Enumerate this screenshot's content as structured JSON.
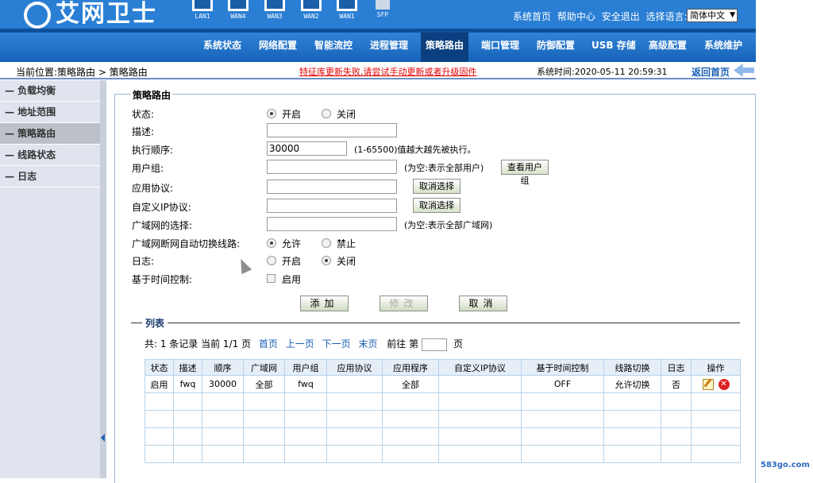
{
  "header": {
    "logo_text": "艾网卫士",
    "ports": [
      "LAN1",
      "WAN4",
      "WAN3",
      "WAN2",
      "WAN1",
      "SFP"
    ],
    "top_links": [
      "系统首页",
      "帮助中心",
      "安全退出",
      "选择语言:"
    ],
    "language": "简体中文"
  },
  "menu": [
    "系统状态",
    "网络配置",
    "智能流控",
    "进程管理",
    "策略路由",
    "端口管理",
    "防御配置",
    "USB 存储",
    "高级配置",
    "系统维护"
  ],
  "active_menu": "策略路由",
  "locbar": {
    "location": "当前位置:策略路由 > 策略路由",
    "warning": "特征库更新失败,请尝试手动更新或者升级固件",
    "system_time": "系统时间:2020-05-11 20:59:31",
    "back_home": "返回首页"
  },
  "sidebar": [
    "— 负载均衡",
    "— 地址范围",
    "— 策略路由",
    "— 线路状态",
    "— 日志"
  ],
  "form": {
    "legend": "策略路由",
    "status_label": "状态:",
    "status_on": "开启",
    "status_off": "关闭",
    "desc_label": "描述:",
    "desc_value": "",
    "order_label": "执行顺序:",
    "order_value": "30000",
    "order_hint": "(1-65500)值越大越先被执行。",
    "usergroup_label": "用户组:",
    "usergroup_hint": "(为空:表示全部用户)",
    "usergroup_btn": "查看用户组",
    "app_label": "应用协议:",
    "cancel_select": "取消选择",
    "custom_ip_label": "自定义IP协议:",
    "wan_label": "广域网的选择:",
    "wan_hint": "(为空:表示全部广域网)",
    "auto_switch_label": "广域网断网自动切换线路:",
    "allow": "允许",
    "forbid": "禁止",
    "log_label": "日志:",
    "log_on": "开启",
    "log_off": "关闭",
    "time_ctrl_label": "基于时间控制:",
    "time_ctrl_enable": "启用",
    "add_btn": "添加",
    "modify_btn": "修改",
    "cancel_btn": "取消"
  },
  "list": {
    "legend": "列表",
    "summary": "共: 1 条记录 当前 1/1 页",
    "first": "首页",
    "prev": "上一页",
    "next": "下一页",
    "last": "末页",
    "goto": "前往 第",
    "page_unit": "页",
    "columns": [
      "状态",
      "描述",
      "顺序",
      "广域网",
      "用户组",
      "应用协议",
      "应用程序",
      "自定义IP协议",
      "基于时间控制",
      "线路切换",
      "日志",
      "操作"
    ],
    "rows": [
      [
        "启用",
        "fwq",
        "30000",
        "全部",
        "fwq",
        "",
        "全部",
        "",
        "OFF",
        "允许切换",
        "否",
        ""
      ]
    ]
  },
  "watermark": "583go.com"
}
